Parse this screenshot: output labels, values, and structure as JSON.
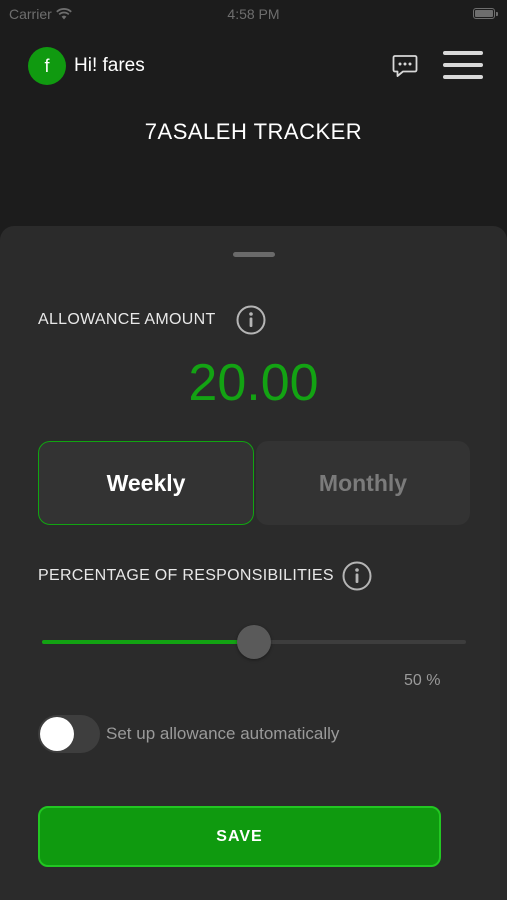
{
  "status_bar": {
    "carrier": "Carrier",
    "time": "4:58 PM",
    "wifi_icon": "wifi-icon",
    "battery_icon": "battery-icon"
  },
  "header": {
    "avatar_initial": "f",
    "greeting": "Hi! fares",
    "chat_icon": "chat-bubble-icon",
    "menu_icon": "hamburger-menu-icon",
    "app_title": "7ASALEH TRACKER"
  },
  "allowance": {
    "label": "ALLOWANCE AMOUNT",
    "info_icon": "info-icon",
    "amount": "20.00"
  },
  "frequency": {
    "options": [
      {
        "label": "Weekly",
        "selected": true
      },
      {
        "label": "Monthly",
        "selected": false
      }
    ]
  },
  "responsibilities": {
    "label": "PERCENTAGE OF RESPONSIBILITIES",
    "info_icon": "info-icon",
    "value": 50,
    "value_text": "50 %"
  },
  "auto_allowance": {
    "label": "Set up allowance automatically",
    "enabled": false
  },
  "save_label": "SAVE",
  "colors": {
    "background": "#1c1c1c",
    "sheet": "#2b2b2b",
    "accent_green": "#13a313",
    "button_green": "#0f9a0f",
    "muted_text": "#9a9a9a"
  }
}
